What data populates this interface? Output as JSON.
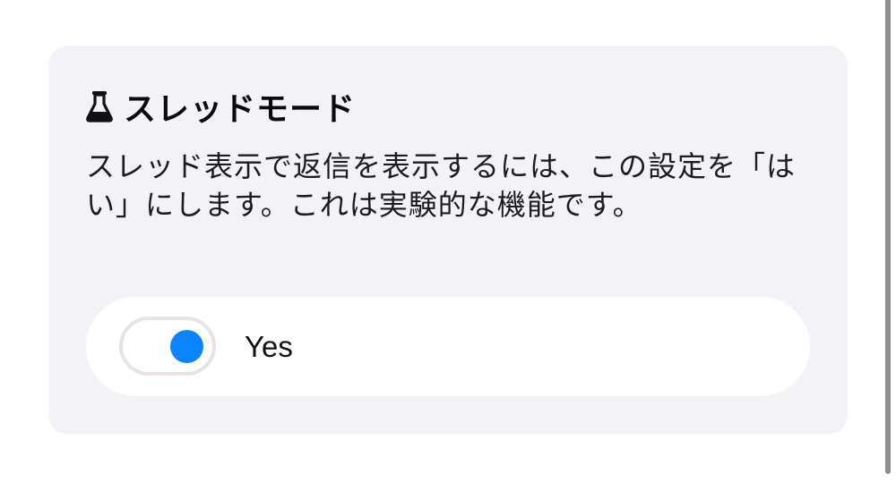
{
  "setting": {
    "icon": "flask-icon",
    "title": "スレッドモード",
    "description": "スレッド表示で返信を表示するには、この設定を「はい」にします。これは実験的な機能です。",
    "toggle": {
      "state": "on",
      "label": "Yes"
    }
  },
  "colors": {
    "card_background": "#f2f2f7",
    "toggle_row_background": "#ffffff",
    "knob_on": "#0a84ff",
    "switch_border": "#e9e2e2",
    "scrollbar": "#8e8e93"
  }
}
